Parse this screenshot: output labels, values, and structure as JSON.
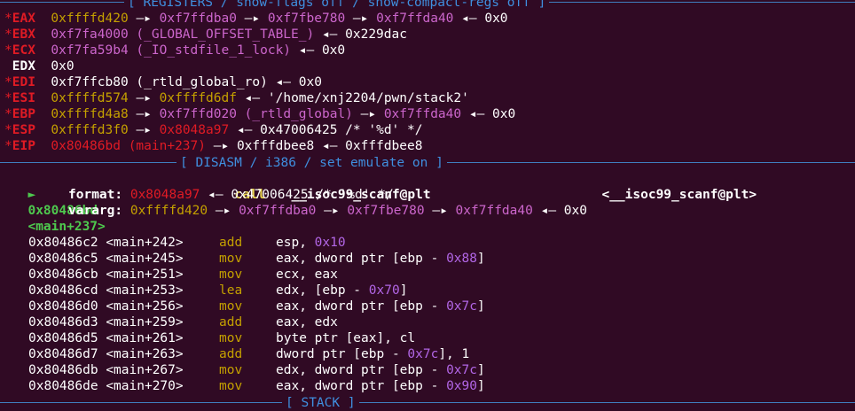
{
  "banners": {
    "registers": "[ REGISTERS / show-flags off / show-compact-regs off ]",
    "disasm": "[ DISASM / i386 / set emulate on ]",
    "stack": "[ STACK ]"
  },
  "registers": [
    {
      "star": "*",
      "name": "EAX",
      "modified": true,
      "chain": [
        {
          "t": "0xffffd420",
          "c": "addr-stack"
        },
        {
          "t": " —▸ ",
          "c": "white"
        },
        {
          "t": "0xf7ffdba0",
          "c": "addr-heap"
        },
        {
          "t": " —▸ ",
          "c": "white"
        },
        {
          "t": "0xf7fbe780",
          "c": "addr-heap"
        },
        {
          "t": " —▸ ",
          "c": "white"
        },
        {
          "t": "0xf7ffda40",
          "c": "addr-heap"
        },
        {
          "t": " ◂— ",
          "c": "white"
        },
        {
          "t": "0x0",
          "c": "white"
        }
      ]
    },
    {
      "star": "*",
      "name": "EBX",
      "modified": true,
      "chain": [
        {
          "t": "0xf7fa4000 (_GLOBAL_OFFSET_TABLE_)",
          "c": "addr-heap"
        },
        {
          "t": " ◂— ",
          "c": "white"
        },
        {
          "t": "0x229dac",
          "c": "white"
        }
      ]
    },
    {
      "star": "*",
      "name": "ECX",
      "modified": true,
      "chain": [
        {
          "t": "0xf7fa59b4 (_IO_stdfile_1_lock)",
          "c": "addr-heap"
        },
        {
          "t": " ◂— ",
          "c": "white"
        },
        {
          "t": "0x0",
          "c": "white"
        }
      ]
    },
    {
      "star": " ",
      "name": "EDX",
      "modified": false,
      "chain": [
        {
          "t": "0x0",
          "c": "white"
        }
      ]
    },
    {
      "star": "*",
      "name": "EDI",
      "modified": true,
      "chain": [
        {
          "t": "0xf7ffcb80 (_rtld_global_ro)",
          "c": "white"
        },
        {
          "t": " ◂— ",
          "c": "white"
        },
        {
          "t": "0x0",
          "c": "white"
        }
      ]
    },
    {
      "star": "*",
      "name": "ESI",
      "modified": true,
      "chain": [
        {
          "t": "0xffffd574",
          "c": "addr-stack"
        },
        {
          "t": " —▸ ",
          "c": "white"
        },
        {
          "t": "0xffffd6df",
          "c": "addr-stack"
        },
        {
          "t": " ◂— ",
          "c": "white"
        },
        {
          "t": "'/home/xnj2204/pwn/stack2'",
          "c": "white"
        }
      ]
    },
    {
      "star": "*",
      "name": "EBP",
      "modified": true,
      "chain": [
        {
          "t": "0xffffd4a8",
          "c": "addr-stack"
        },
        {
          "t": " —▸ ",
          "c": "white"
        },
        {
          "t": "0xf7ffd020 (_rtld_global)",
          "c": "addr-heap"
        },
        {
          "t": " —▸ ",
          "c": "white"
        },
        {
          "t": "0xf7ffda40",
          "c": "addr-heap"
        },
        {
          "t": " ◂— ",
          "c": "white"
        },
        {
          "t": "0x0",
          "c": "white"
        }
      ]
    },
    {
      "star": "*",
      "name": "ESP",
      "modified": true,
      "chain": [
        {
          "t": "0xffffd3f0",
          "c": "addr-stack"
        },
        {
          "t": " —▸ ",
          "c": "white"
        },
        {
          "t": "0x8048a97",
          "c": "addr-code"
        },
        {
          "t": " ◂— ",
          "c": "white"
        },
        {
          "t": "0x47006425 /* '%d' */",
          "c": "white"
        }
      ]
    },
    {
      "star": "*",
      "name": "EIP",
      "modified": true,
      "chain": [
        {
          "t": "0x80486bd (main+237)",
          "c": "addr-code"
        },
        {
          "t": " —▸ ",
          "c": "white"
        },
        {
          "t": "0xfffdbee8",
          "c": "white"
        },
        {
          "t": " ◂— ",
          "c": "white"
        },
        {
          "t": "0xfffdbee8",
          "c": "white"
        }
      ]
    }
  ],
  "current": {
    "marker": "►",
    "addr": "0x80486bd",
    "sym": "<main+237>",
    "mnem": "call",
    "operand": "__isoc99_scanf@plt",
    "target": "<__isoc99_scanf@plt>"
  },
  "args": [
    {
      "label": "format:",
      "chain": [
        {
          "t": "0x8048a97",
          "c": "addr-code"
        },
        {
          "t": " ◂— ",
          "c": "white"
        },
        {
          "t": "0x47006425 /* '%d' */",
          "c": "white"
        }
      ]
    },
    {
      "label": "vararg:",
      "chain": [
        {
          "t": "0xffffd420",
          "c": "addr-stack"
        },
        {
          "t": " —▸ ",
          "c": "white"
        },
        {
          "t": "0xf7ffdba0",
          "c": "addr-heap"
        },
        {
          "t": " —▸ ",
          "c": "white"
        },
        {
          "t": "0xf7fbe780",
          "c": "addr-heap"
        },
        {
          "t": " —▸ ",
          "c": "white"
        },
        {
          "t": "0xf7ffda40",
          "c": "addr-heap"
        },
        {
          "t": " ◂— ",
          "c": "white"
        },
        {
          "t": "0x0",
          "c": "white"
        }
      ]
    }
  ],
  "disasm": [
    {
      "addr": "0x80486c2",
      "sym": "<main+242>",
      "mnem": "add",
      "ops": [
        {
          "t": "esp, "
        },
        {
          "t": "0x10",
          "n": true
        }
      ]
    },
    {
      "addr": "0x80486c5",
      "sym": "<main+245>",
      "mnem": "mov",
      "ops": [
        {
          "t": "eax, dword ptr [ebp - "
        },
        {
          "t": "0x88",
          "n": true
        },
        {
          "t": "]"
        }
      ]
    },
    {
      "addr": "0x80486cb",
      "sym": "<main+251>",
      "mnem": "mov",
      "ops": [
        {
          "t": "ecx, eax"
        }
      ]
    },
    {
      "addr": "0x80486cd",
      "sym": "<main+253>",
      "mnem": "lea",
      "ops": [
        {
          "t": "edx, [ebp - "
        },
        {
          "t": "0x70",
          "n": true
        },
        {
          "t": "]"
        }
      ]
    },
    {
      "addr": "0x80486d0",
      "sym": "<main+256>",
      "mnem": "mov",
      "ops": [
        {
          "t": "eax, dword ptr [ebp - "
        },
        {
          "t": "0x7c",
          "n": true
        },
        {
          "t": "]"
        }
      ]
    },
    {
      "addr": "0x80486d3",
      "sym": "<main+259>",
      "mnem": "add",
      "ops": [
        {
          "t": "eax, edx"
        }
      ]
    },
    {
      "addr": "0x80486d5",
      "sym": "<main+261>",
      "mnem": "mov",
      "ops": [
        {
          "t": "byte ptr [eax], cl"
        }
      ]
    },
    {
      "addr": "0x80486d7",
      "sym": "<main+263>",
      "mnem": "add",
      "ops": [
        {
          "t": "dword ptr [ebp - "
        },
        {
          "t": "0x7c",
          "n": true
        },
        {
          "t": "], 1"
        }
      ]
    },
    {
      "addr": "0x80486db",
      "sym": "<main+267>",
      "mnem": "mov",
      "ops": [
        {
          "t": "edx, dword ptr [ebp - "
        },
        {
          "t": "0x7c",
          "n": true
        },
        {
          "t": "]"
        }
      ]
    },
    {
      "addr": "0x80486de",
      "sym": "<main+270>",
      "mnem": "mov",
      "ops": [
        {
          "t": "eax, dword ptr [ebp - "
        },
        {
          "t": "0x90",
          "n": true
        },
        {
          "t": "]"
        }
      ]
    }
  ],
  "colors": {
    "background": "#300a24",
    "banner": "#3f8fdf",
    "register_modified": "#e01b24",
    "stack_address": "#c4a000",
    "mapped_address": "#cc66cc",
    "code_address": "#e01b24",
    "current_instruction": "#4ec94e"
  }
}
